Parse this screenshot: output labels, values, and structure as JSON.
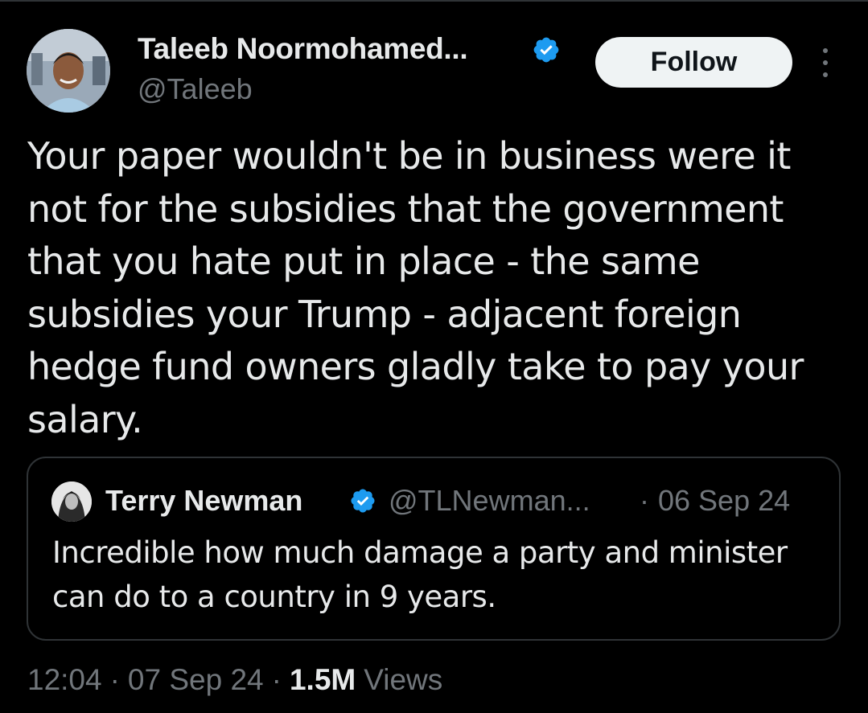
{
  "tweet": {
    "author": {
      "name": "Taleeb Noormohamed...",
      "handle": "@Taleeb",
      "verified": true
    },
    "follow_label": "Follow",
    "text": "Your paper wouldn't be in business were it not for the subsidies that the government that you hate put in place - the same subsidies your Trump - adjacent foreign hedge fund owners gladly take to pay your salary.",
    "quoted": {
      "author_name": "Terry Newman",
      "handle": "@TLNewman...",
      "separator": "·",
      "date": "06 Sep 24",
      "text": "Incredible how much damage a party and minister can do to a country in 9 years.",
      "verified": true
    },
    "meta": {
      "time": "12:04",
      "date": "07 Sep 24",
      "views_count": "1.5M",
      "views_label": "Views",
      "separator": "·"
    }
  },
  "icons": {
    "verified": "verified-badge-icon",
    "more": "more-options-icon"
  },
  "colors": {
    "background": "#000000",
    "primary_text": "#e7e9ea",
    "secondary_text": "#71767b",
    "verified_blue": "#1d9bf0",
    "button_bg": "#eff3f4",
    "border": "#2f3336"
  }
}
